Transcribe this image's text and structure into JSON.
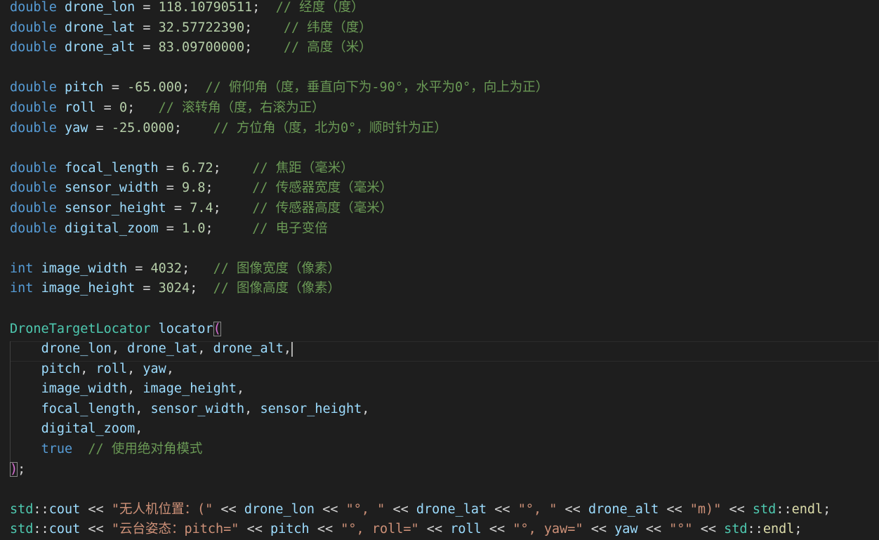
{
  "code": {
    "l1": {
      "kw": "double",
      "var": "drone_lon",
      "num": "118.10790511",
      "cmt": "// 经度（度）"
    },
    "l2": {
      "kw": "double",
      "var": "drone_lat",
      "num": "32.57722390",
      "cmt": "// 纬度（度）"
    },
    "l3": {
      "kw": "double",
      "var": "drone_alt",
      "num": "83.09700000",
      "cmt": "// 高度（米）"
    },
    "l5": {
      "kw": "double",
      "var": "pitch",
      "num": "-65.000",
      "cmt": "// 俯仰角（度，垂直向下为-90°，水平为0°，向上为正）"
    },
    "l6": {
      "kw": "double",
      "var": "roll",
      "num": "0",
      "cmt": "// 滚转角（度，右滚为正）"
    },
    "l7": {
      "kw": "double",
      "var": "yaw",
      "num": "-25.0000",
      "cmt": "// 方位角（度，北为0°，顺时针为正）"
    },
    "l9": {
      "kw": "double",
      "var": "focal_length",
      "num": "6.72",
      "cmt": "// 焦距（毫米）"
    },
    "l10": {
      "kw": "double",
      "var": "sensor_width",
      "num": "9.8",
      "cmt": "// 传感器宽度（毫米）"
    },
    "l11": {
      "kw": "double",
      "var": "sensor_height",
      "num": "7.4",
      "cmt": "// 传感器高度（毫米）"
    },
    "l12": {
      "kw": "double",
      "var": "digital_zoom",
      "num": "1.0",
      "cmt": "// 电子变倍"
    },
    "l14": {
      "kw": "int",
      "var": "image_width",
      "num": "4032",
      "cmt": "// 图像宽度（像素）"
    },
    "l15": {
      "kw": "int",
      "var": "image_height",
      "num": "3024",
      "cmt": "// 图像高度（像素）"
    },
    "l17": {
      "type": "DroneTargetLocator",
      "var": "locator"
    },
    "l18": {
      "a": "drone_lon",
      "b": "drone_lat",
      "c": "drone_alt"
    },
    "l19": {
      "a": "pitch",
      "b": "roll",
      "c": "yaw"
    },
    "l20": {
      "a": "image_width",
      "b": "image_height"
    },
    "l21": {
      "a": "focal_length",
      "b": "sensor_width",
      "c": "sensor_height"
    },
    "l22": {
      "a": "digital_zoom"
    },
    "l23": {
      "kw": "true",
      "cmt": "// 使用绝对角模式"
    },
    "l26": {
      "ns": "std",
      "fn": "cout",
      "s1": "\"无人机位置：(\"",
      "v1": "drone_lon",
      "s2": "\"°, \"",
      "v2": "drone_lat",
      "s3": "\"°, \"",
      "v3": "drone_alt",
      "s4": "\"m)\"",
      "ns2": "std",
      "fn2": "endl"
    },
    "l27": {
      "ns": "std",
      "fn": "cout",
      "s1": "\"云台姿态：pitch=\"",
      "v1": "pitch",
      "s2": "\"°, roll=\"",
      "v2": "roll",
      "s3": "\"°, yaw=\"",
      "v3": "yaw",
      "s4": "\"°\"",
      "ns2": "std",
      "fn2": "endl"
    }
  }
}
